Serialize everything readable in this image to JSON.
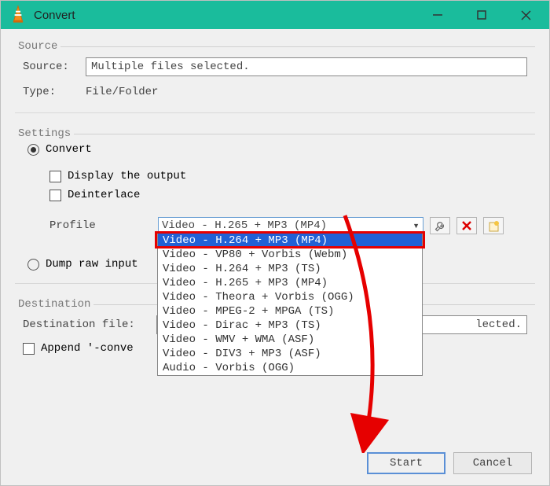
{
  "titlebar": {
    "title": "Convert"
  },
  "source": {
    "legend": "Source",
    "source_label": "Source:",
    "source_value": "Multiple files selected.",
    "type_label": "Type:",
    "type_value": "File/Folder"
  },
  "settings": {
    "legend": "Settings",
    "convert_label": "Convert",
    "display_output_label": "Display the output",
    "deinterlace_label": "Deinterlace",
    "profile_label": "Profile",
    "profile_selected": "Video - H.265 + MP3 (MP4)",
    "profile_options": [
      "Video - H.264 + MP3 (MP4)",
      "Video - VP80 + Vorbis (Webm)",
      "Video - H.264 + MP3 (TS)",
      "Video - H.265 + MP3 (MP4)",
      "Video - Theora + Vorbis (OGG)",
      "Video - MPEG-2 + MPGA (TS)",
      "Video - Dirac + MP3 (TS)",
      "Video - WMV + WMA (ASF)",
      "Video - DIV3 + MP3 (ASF)",
      "Audio - Vorbis (OGG)"
    ],
    "dump_label": "Dump raw input"
  },
  "destination": {
    "legend": "Destination",
    "file_label": "Destination file:",
    "file_value": "lected.",
    "append_label": "Append '-conve"
  },
  "buttons": {
    "start": "Start",
    "cancel": "Cancel"
  },
  "icons": {
    "wrench": "wrench-icon",
    "delete": "delete-icon",
    "new": "new-profile-icon"
  }
}
